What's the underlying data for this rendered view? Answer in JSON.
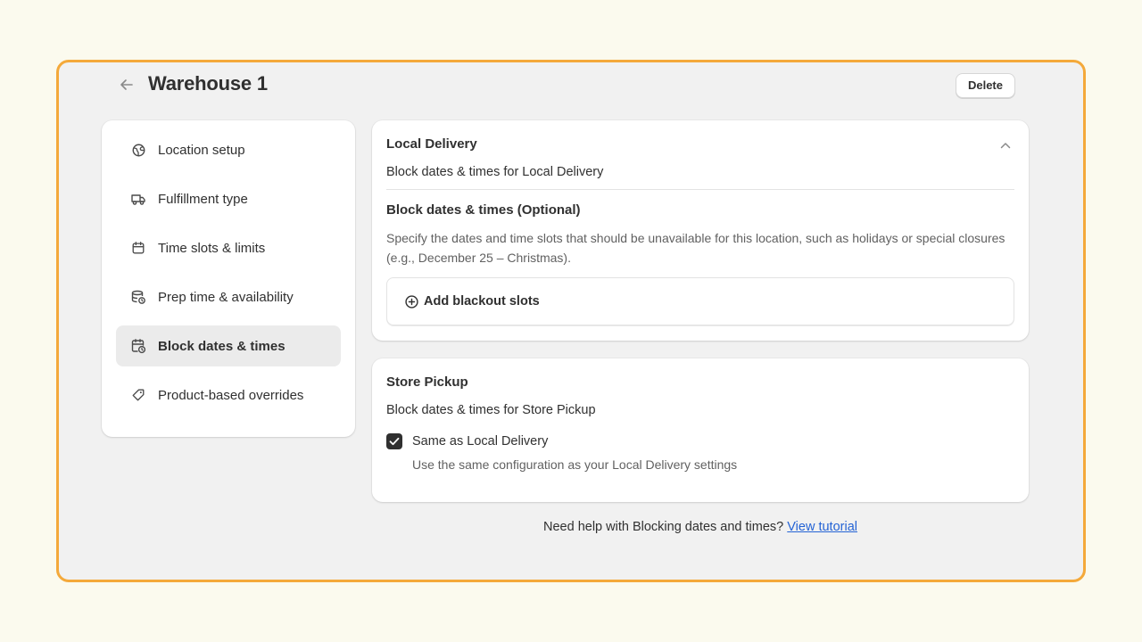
{
  "header": {
    "back_icon": "arrow-left-icon",
    "title": "Warehouse 1",
    "delete_label": "Delete"
  },
  "sidebar": {
    "items": [
      {
        "label": "Location setup",
        "icon": "location-globe-icon",
        "active": false
      },
      {
        "label": "Fulfillment type",
        "icon": "delivery-truck-icon",
        "active": false
      },
      {
        "label": "Time slots & limits",
        "icon": "calendar-icon",
        "active": false
      },
      {
        "label": "Prep time & availability",
        "icon": "database-clock-icon",
        "active": false
      },
      {
        "label": "Block dates & times",
        "icon": "calendar-clock-icon",
        "active": true
      },
      {
        "label": "Product-based overrides",
        "icon": "tag-icon",
        "active": false
      }
    ]
  },
  "local_delivery": {
    "title": "Local Delivery",
    "subtitle": "Block dates & times for Local Delivery",
    "section_title": "Block dates & times (Optional)",
    "section_desc": "Specify the dates and time slots that should be unavailable for this location, such as holidays or special closures (e.g., December 25 – Christmas).",
    "add_label": "Add blackout slots"
  },
  "store_pickup": {
    "title": "Store Pickup",
    "subtitle": "Block dates & times for Store Pickup",
    "checkbox_label": "Same as Local Delivery",
    "checkbox_checked": true,
    "checkbox_help": "Use the same configuration as your Local Delivery settings"
  },
  "help": {
    "text": "Need help with Blocking dates and times?",
    "link": "View tutorial"
  },
  "colors": {
    "frame_border": "#f4a93a",
    "page_bg": "#fbfaee",
    "link": "#2463d5"
  }
}
